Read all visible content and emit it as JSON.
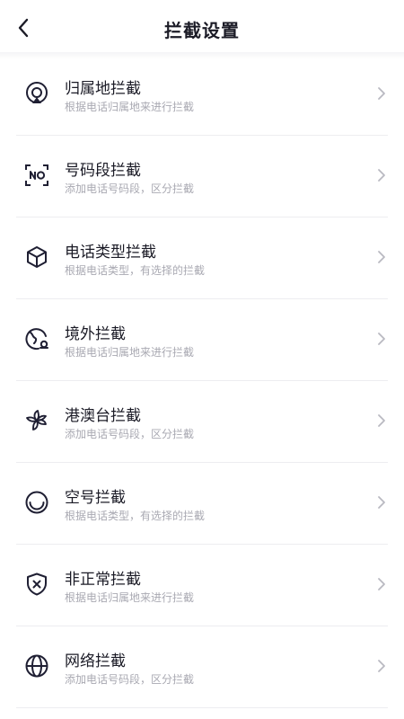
{
  "header": {
    "title": "拦截设置"
  },
  "items": [
    {
      "title": "归属地拦截",
      "subtitle": "根据电话归属地来进行拦截",
      "icon": "location-pin-icon"
    },
    {
      "title": "号码段拦截",
      "subtitle": "添加电话号码段，区分拦截",
      "icon": "number-segment-icon"
    },
    {
      "title": "电话类型拦截",
      "subtitle": "根据电话类型，有选择的拦截",
      "icon": "cube-icon"
    },
    {
      "title": "境外拦截",
      "subtitle": "根据电话归属地来进行拦截",
      "icon": "globe-phone-icon"
    },
    {
      "title": "港澳台拦截",
      "subtitle": "添加电话号码段，区分拦截",
      "icon": "bauhinia-flower-icon"
    },
    {
      "title": "空号拦截",
      "subtitle": "根据电话类型，有选择的拦截",
      "icon": "empty-circle-icon"
    },
    {
      "title": "非正常拦截",
      "subtitle": "根据电话归属地来进行拦截",
      "icon": "shield-x-icon"
    },
    {
      "title": "网络拦截",
      "subtitle": "添加电话号码段，区分拦截",
      "icon": "globe-icon"
    }
  ]
}
